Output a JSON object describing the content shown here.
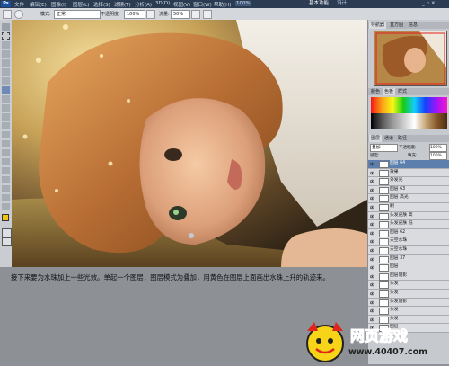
{
  "menubar": {
    "items": [
      "文件",
      "编辑(E)",
      "图像(I)",
      "图层(L)",
      "选择(S)",
      "滤镜(T)",
      "分析(A)",
      "3D(D)",
      "视图(V)",
      "窗口(W)",
      "帮助(H)"
    ],
    "zoom": "100%",
    "workspaces": [
      "基本功能",
      "设计"
    ],
    "active_workspace": "基本功能"
  },
  "options": {
    "mode_label": "模式:",
    "mode_value": "正常",
    "opacity_label": "不透明度:",
    "opacity_value": "100%",
    "flow_label": "流量:",
    "flow_value": "50%"
  },
  "panels": {
    "navigator_tabs": [
      "导航器",
      "直方图",
      "信息"
    ],
    "swatch_tabs": [
      "颜色",
      "色板",
      "样式"
    ],
    "layer_tabs": [
      "图层",
      "通道",
      "路径"
    ],
    "blend_mode": "叠加",
    "opacity_label": "不透明度:",
    "opacity_value": "100%",
    "lock_label": "锁定:",
    "fill_label": "填充:",
    "fill_value": "100%",
    "layers": [
      "图层 64",
      "效果",
      "外发光",
      "图层 63",
      "图层 高光",
      "刷",
      "头发皮肤 高",
      "头发皮肤 低",
      "图层 62",
      "天空水珠",
      "天空水珠",
      "图层 37",
      "图层",
      "图层阴影",
      "头发",
      "头发",
      "头发阴影",
      "头发",
      "头发",
      "图层"
    ]
  },
  "caption": "接下来要为水珠加上一些光效。单起一个图层，图层模式为叠加，用黄色在图层上面画出水珠上升的轨迹来。",
  "watermark": {
    "title": "网页游戏",
    "url": "www.40407.com"
  },
  "colors": {
    "menubar_bg": "#2a3b52",
    "panel_bg": "#c6c9ce",
    "selected_layer": "#5d7fae",
    "watermark_red": "#e0261b",
    "watermark_yellow": "#f7d417"
  }
}
